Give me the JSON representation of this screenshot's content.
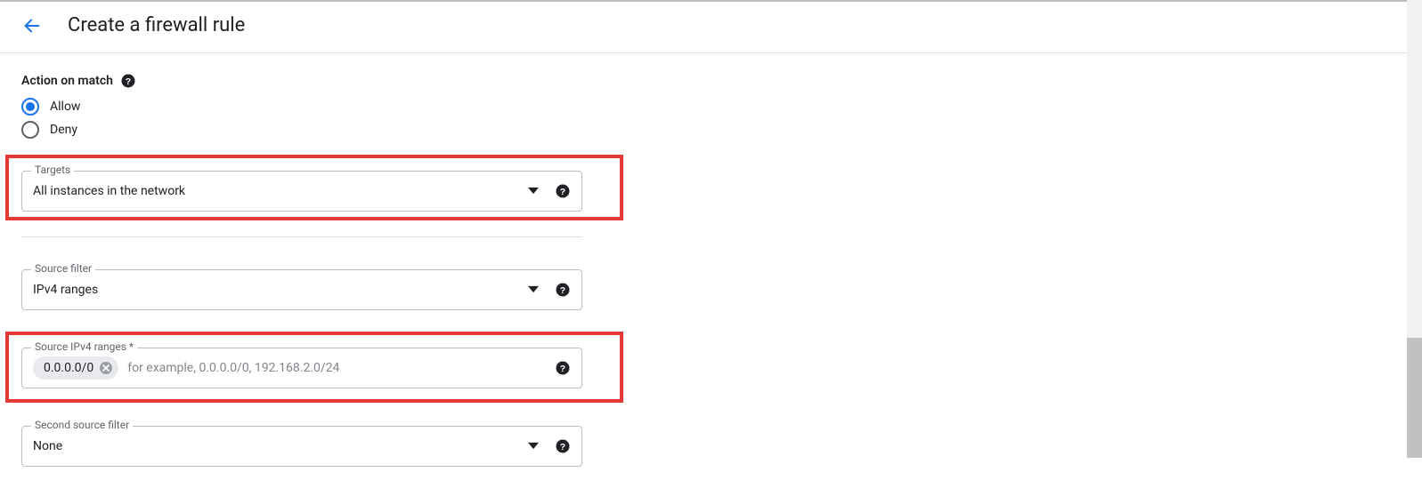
{
  "header": {
    "title": "Create a firewall rule"
  },
  "action_on_match": {
    "label": "Action on match",
    "options": {
      "allow": "Allow",
      "deny": "Deny"
    }
  },
  "targets": {
    "label": "Targets",
    "value": "All instances in the network"
  },
  "source_filter": {
    "label": "Source filter",
    "value": "IPv4 ranges"
  },
  "source_ipv4": {
    "label": "Source IPv4 ranges *",
    "chip": "0.0.0.0/0",
    "placeholder": "for example, 0.0.0.0/0, 192.168.2.0/24"
  },
  "second_source_filter": {
    "label": "Second source filter",
    "value": "None"
  }
}
